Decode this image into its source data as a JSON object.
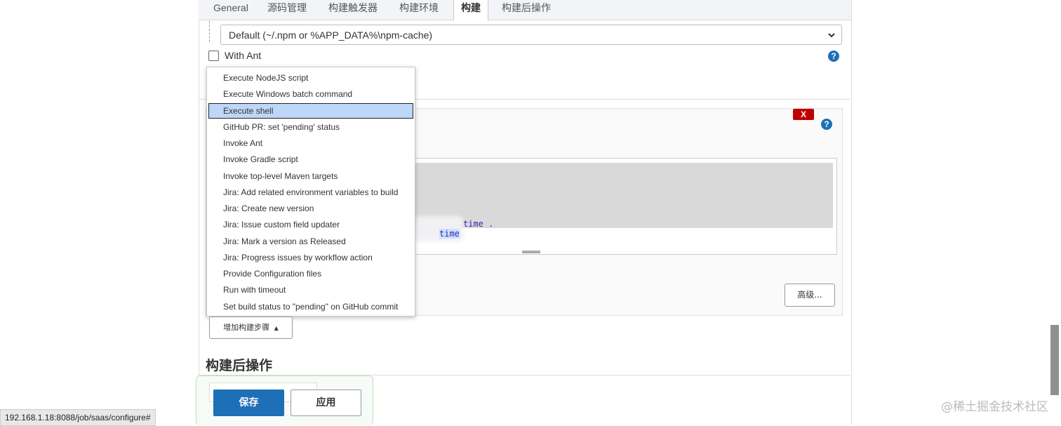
{
  "tabs": [
    "General",
    "源码管理",
    "构建触发器",
    "构建环境",
    "构建",
    "构建后操作"
  ],
  "active_tab_index": 4,
  "npm_cache_select": {
    "value": "Default (~/.npm or %APP_DATA%\\npm-cache)"
  },
  "with_ant": {
    "label": "With Ant",
    "checked": false
  },
  "help_icon_glyph": "?",
  "delete_label": "X",
  "code": {
    "line1": "time .",
    "line2": "time"
  },
  "advanced_button": "高级...",
  "dropdown": {
    "items": [
      "Execute NodeJS script",
      "Execute Windows batch command",
      "Execute shell",
      "GitHub PR: set 'pending' status",
      "Invoke Ant",
      "Invoke Gradle script",
      "Invoke top-level Maven targets",
      "Jira: Add related environment variables to build",
      "Jira: Create new version",
      "Jira: Issue custom field updater",
      "Jira: Mark a version as Released",
      "Jira: Progress issues by workflow action",
      "Provide Configuration files",
      "Run with timeout",
      "Set build status to \"pending\" on GitHub commit"
    ],
    "selected_index": 2
  },
  "add_build_step": {
    "label": "增加构建步骤",
    "arrow": "▲"
  },
  "post_build_title": "构建后操作",
  "save_button": "保存",
  "apply_button": "应用",
  "status_url": "192.168.1.18:8088/job/saas/configure#",
  "watermark": "@稀土掘金技术社区"
}
